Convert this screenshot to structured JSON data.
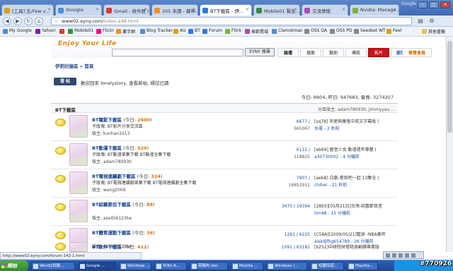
{
  "browser": {
    "tabs": [
      {
        "label": "[工具] 五/Few v...",
        "color": "#d6a018"
      },
      {
        "label": "iGoogle",
        "color": "#4a8ed8"
      },
      {
        "label": "Gmail - 收件匣 (...",
        "color": "#d23f31"
      },
      {
        "label": "205 未讀 - 蘇神...",
        "color": "#e8912c"
      },
      {
        "label": "BT下載區 - 伊...",
        "color": "#2f7bd1"
      },
      {
        "label": "Mobile01 緊急...",
        "color": "#3a8a3e"
      },
      {
        "label": "交流情懷",
        "color": "#b04bb0"
      },
      {
        "label": "Nvidia: Manage...",
        "color": "#7bb33a"
      }
    ],
    "user_name": "Google",
    "url_domain": "www02.eyny.com/",
    "url_path": "index-248.html",
    "bookmarks": [
      {
        "label": "My Google",
        "color": "#4a8ed8"
      },
      {
        "label": "Yahoo!",
        "color": "#7a1fb0"
      },
      {
        "label": "",
        "color": "#d23f31"
      },
      {
        "label": "Mobile01",
        "color": "#3a8a3e"
      },
      {
        "label": "Flickr",
        "color": "#ff0084"
      },
      {
        "label": "薯芋網",
        "color": "#e8912c"
      },
      {
        "label": "Blog Tracker",
        "color": "#4a8ed8"
      },
      {
        "label": "AU",
        "color": "#d6a018"
      },
      {
        "label": "BT",
        "color": "#2f7bd1"
      },
      {
        "label": "Forum",
        "color": "#2f7bd1"
      },
      {
        "label": "Flink",
        "color": "#7bb33a"
      },
      {
        "label": "章節異域",
        "color": "#b04bb0"
      },
      {
        "label": "Clamotman",
        "color": "#4a8ed8"
      },
      {
        "label": "OSS QA",
        "color": "#888888"
      },
      {
        "label": "OSS PD",
        "color": "#888888"
      },
      {
        "label": "Seedset WT",
        "color": "#888888"
      },
      {
        "label": "Feel",
        "color": "#d6a018"
      }
    ],
    "other_bookmarks": "其他書籤",
    "status_url": "http://www02.eyny.com/forum-142-1.html"
  },
  "site": {
    "logo": "Enjoy Your Life",
    "search_button": "EYNY 搜尋",
    "menu": [
      "論壇",
      "搜索",
      "幫助",
      "導航",
      "影片",
      "部落格",
      "尊貴會員"
    ],
    "breadcrumb": "伊莉討論區 » 首頁",
    "post_button": "發 帖",
    "welcome": "歡迎回來 lonelystory, 查看新帖, 標記已讀",
    "stats": "今日: 8804, 昨日: 947683, 會員: 3274207"
  },
  "section": {
    "name": "BT下載區",
    "moderators": "分區版主: adam780930,  jimmyyau ..."
  },
  "forums": [
    {
      "name": "BT電影下載區",
      "today_label": "(今日: ",
      "today": "2600",
      "today_end": ")",
      "sub": "子版塊: BT影片分享交流區",
      "moderator": "版主: kunhan1013",
      "topics": "6677 /",
      "posts": "565067",
      "last_title": "[sq78] 天使與魔鬼中英文字幕版 (",
      "last_user": "水電 - 2 秒前"
    },
    {
      "name": "BT動漫下載區",
      "today_label": "(今日: ",
      "today": "529",
      "today_end": ")",
      "sub": "子版塊: BT動漫單集下載  BT動漫全集下載",
      "moderator": "版主: adam780930",
      "topics": "6111 /",
      "posts": "118825",
      "last_title": "[eb69] 輕音少女 動漫週年專題 (",
      "last_user": "a30730002 - 4 分鐘前"
    },
    {
      "name": "BT電視連續劇下載區",
      "today_label": "(今日: ",
      "today": "324",
      "today_end": ")",
      "sub": "子版塊: BT電視連續劇單集下載  BT電視連續劇全集下載",
      "moderator": "版主: wang2009",
      "topics": "7907 /",
      "posts": "16852911",
      "last_title": "[aeb8] 白劇-愛我吧一起 13集全 (",
      "last_user": "chiher - 21 秒前"
    },
    {
      "name": "BT綜藝節目下載區",
      "today_label": "(今日: ",
      "today": "88",
      "today_end": ")",
      "sub": "",
      "moderator": "版主: ass456123tw",
      "topics": "3470 / 19394",
      "posts": "",
      "last_title": "[28E0][05月21日]台灣-綜藝節目音",
      "last_user": "tim48 - 15 分鐘前"
    },
    {
      "name": "BT體育運動下載區",
      "today_label": "(今日: ",
      "today": "36",
      "today_end": ")",
      "sub": "",
      "moderator": "版主: ass456123tw",
      "topics": "1291 / 6225",
      "posts": "",
      "last_title": "[C58A][2009/05/21]籃球 -NBA東岸",
      "last_user": "alskdjfhg654789 - 26 分鐘前"
    },
    {
      "name": "BT軟件下載區",
      "today_label": "(今日: ",
      "today": "412",
      "today_end": ")",
      "sub": "",
      "moderator": "",
      "topics": "1091 / 63181",
      "posts": "",
      "last_title": "[b252]中研院研發隨身翻譯專業版",
      "last_user": ""
    }
  ],
  "taskbar": {
    "start": "開始",
    "tasks": [
      "Word\\[試錄...",
      "Google ...",
      "Windows ...",
      "ToTel A...",
      "剪輯夾.doc",
      "Mozilla ...",
      "Windows I...",
      "短驗回道...",
      "Filezilla..."
    ],
    "watermark": "#770926"
  }
}
